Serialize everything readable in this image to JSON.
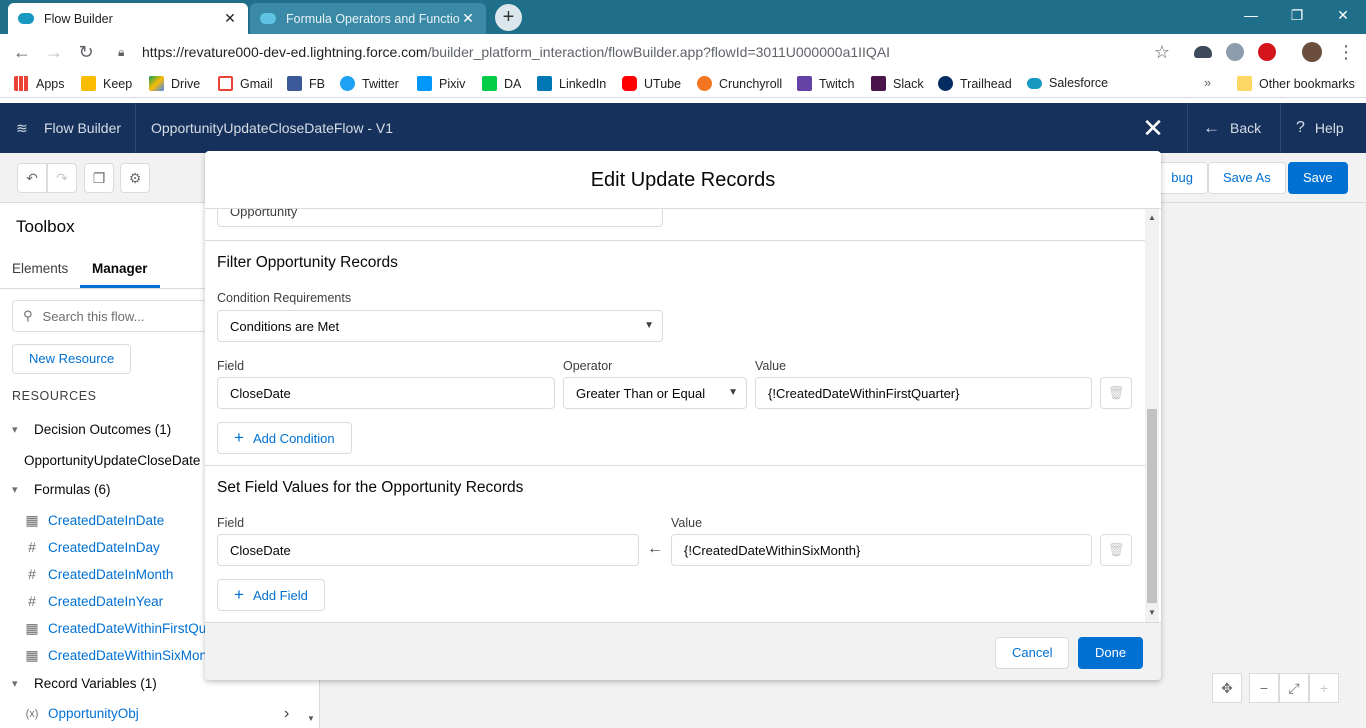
{
  "browser": {
    "tabs": [
      {
        "title": "Flow Builder",
        "active": true
      },
      {
        "title": "Formula Operators and Functions",
        "active": false
      }
    ],
    "url_host": "https://revature000-dev-ed.lightning.force.com",
    "url_path": "/builder_platform_interaction/flowBuilder.app?flowId=3011U000000a1IIQAI",
    "bookmarks": [
      "Apps",
      "Keep",
      "Drive",
      "Gmail",
      "FB",
      "Twitter",
      "Pixiv",
      "DA",
      "LinkedIn",
      "UTube",
      "Crunchyroll",
      "Twitch",
      "Slack",
      "Trailhead",
      "Salesforce"
    ],
    "other_bookmarks": "Other bookmarks",
    "overflow": "»"
  },
  "header": {
    "app_name": "Flow Builder",
    "flow_name": "OpportunityUpdateCloseDateFlow - V1",
    "back": "Back",
    "help": "Help"
  },
  "toolbar": {
    "debug_partial": "bug",
    "save_as": "Save As",
    "save": "Save"
  },
  "toolbox": {
    "title": "Toolbox",
    "tabs": [
      "Elements",
      "Manager"
    ],
    "search_placeholder": "Search this flow...",
    "new_resource": "New Resource",
    "resources_label": "RESOURCES",
    "sections": {
      "decision": "Decision Outcomes (1)",
      "formulas": "Formulas (6)",
      "record_vars": "Record Variables (1)"
    },
    "decision_item": "OpportunityUpdateCloseDate",
    "formulas": [
      {
        "name": "CreatedDateInDate",
        "icon": "calendar-icon"
      },
      {
        "name": "CreatedDateInDay",
        "icon": "hash-icon"
      },
      {
        "name": "CreatedDateInMonth",
        "icon": "hash-icon"
      },
      {
        "name": "CreatedDateInYear",
        "icon": "hash-icon"
      },
      {
        "name": "CreatedDateWithinFirstQu",
        "icon": "calendar-icon"
      },
      {
        "name": "CreatedDateWithinSixMon",
        "icon": "calendar-icon"
      }
    ],
    "record_var": "OpportunityObj"
  },
  "modal": {
    "title": "Edit Update Records",
    "object_value": "Opportunity",
    "filter_title": "Filter Opportunity Records",
    "condition_req_label": "Condition Requirements",
    "condition_req_value": "Conditions are Met",
    "field_label": "Field",
    "operator_label": "Operator",
    "value_label": "Value",
    "condition": {
      "field": "CloseDate",
      "operator": "Greater Than or Equal",
      "value": "{!CreatedDateWithinFirstQuarter}"
    },
    "add_condition": "Add Condition",
    "set_title": "Set Field Values for the Opportunity Records",
    "assignment": {
      "field": "CloseDate",
      "value": "{!CreatedDateWithinSixMonth}"
    },
    "add_field": "Add Field",
    "cancel": "Cancel",
    "done": "Done"
  }
}
